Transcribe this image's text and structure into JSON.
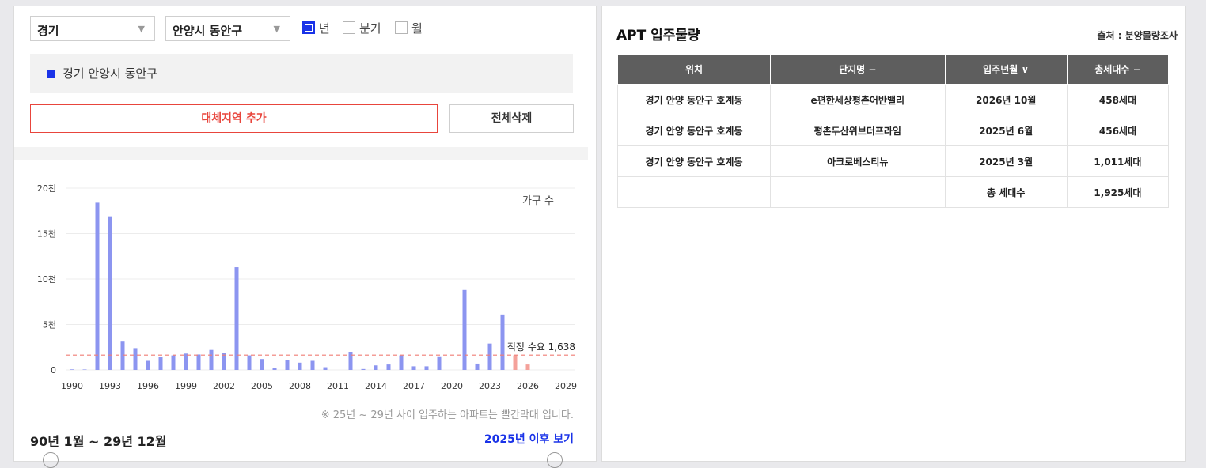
{
  "filters": {
    "province": "경기",
    "district": "안양시 동안구",
    "periods": [
      {
        "label": "년",
        "checked": true
      },
      {
        "label": "분기",
        "checked": false
      },
      {
        "label": "월",
        "checked": false
      }
    ]
  },
  "selected_region": "경기 안양시 동안구",
  "buttons": {
    "add_region": "대체지역 추가",
    "delete_all": "전체삭제"
  },
  "colors": {
    "accent_blue": "#1a33e8",
    "bar_past": "#8c95f0",
    "bar_future": "#f4a19a",
    "demand_line": "#f07d75",
    "add_button": "#e8453c"
  },
  "chart_data": {
    "type": "bar",
    "series_label": "가구 수",
    "categories": [
      "1990",
      "1991",
      "1992",
      "1993",
      "1994",
      "1995",
      "1996",
      "1997",
      "1998",
      "1999",
      "2000",
      "2001",
      "2002",
      "2003",
      "2004",
      "2005",
      "2006",
      "2007",
      "2008",
      "2009",
      "2010",
      "2011",
      "2012",
      "2013",
      "2014",
      "2015",
      "2016",
      "2017",
      "2018",
      "2019",
      "2020",
      "2021",
      "2022",
      "2023",
      "2024",
      "2025",
      "2026",
      "2027",
      "2028",
      "2029"
    ],
    "values": [
      60,
      50,
      18400,
      16900,
      3200,
      2400,
      1000,
      1400,
      1600,
      1800,
      1700,
      2200,
      1900,
      11300,
      1600,
      1200,
      200,
      1100,
      800,
      1000,
      300,
      0,
      2000,
      100,
      500,
      600,
      1600,
      400,
      400,
      1500,
      0,
      8800,
      700,
      2900,
      6100,
      1600,
      600,
      0,
      0,
      0
    ],
    "future_from": "2025",
    "yticks": [
      {
        "v": 0,
        "label": "0"
      },
      {
        "v": 5000,
        "label": "5천"
      },
      {
        "v": 10000,
        "label": "10천"
      },
      {
        "v": 15000,
        "label": "15천"
      },
      {
        "v": 20000,
        "label": "20천"
      }
    ],
    "xticks": [
      "1990",
      "1993",
      "1996",
      "1999",
      "2002",
      "2005",
      "2008",
      "2011",
      "2014",
      "2017",
      "2020",
      "2023",
      "2026",
      "2029"
    ],
    "ylim": [
      0,
      20000
    ],
    "reference_line": {
      "value": 1638,
      "label": "적정 수요 1,638"
    },
    "grid": true
  },
  "chart_note": "※ 25년 ~ 29년 사이 입주하는 아파트는 빨간막대 입니다.",
  "period_label": "90년 1월 ~ 29년 12월",
  "after_link": "2025년 이후 보기",
  "right": {
    "title": "APT 입주물량",
    "source": "출처 : 분양물량조사",
    "headers": [
      "위치",
      "단지명 −",
      "입주년월 ∨",
      "총세대수 −"
    ],
    "rows": [
      [
        "경기 안양 동안구 호계동",
        "e편한세상평촌어반밸리",
        "2026년 10월",
        "458세대"
      ],
      [
        "경기 안양 동안구 호계동",
        "평촌두산위브더프라임",
        "2025년 6월",
        "456세대"
      ],
      [
        "경기 안양 동안구 호계동",
        "아크로베스티뉴",
        "2025년 3월",
        "1,011세대"
      ],
      [
        "",
        "",
        "총 세대수",
        "1,925세대"
      ]
    ]
  }
}
